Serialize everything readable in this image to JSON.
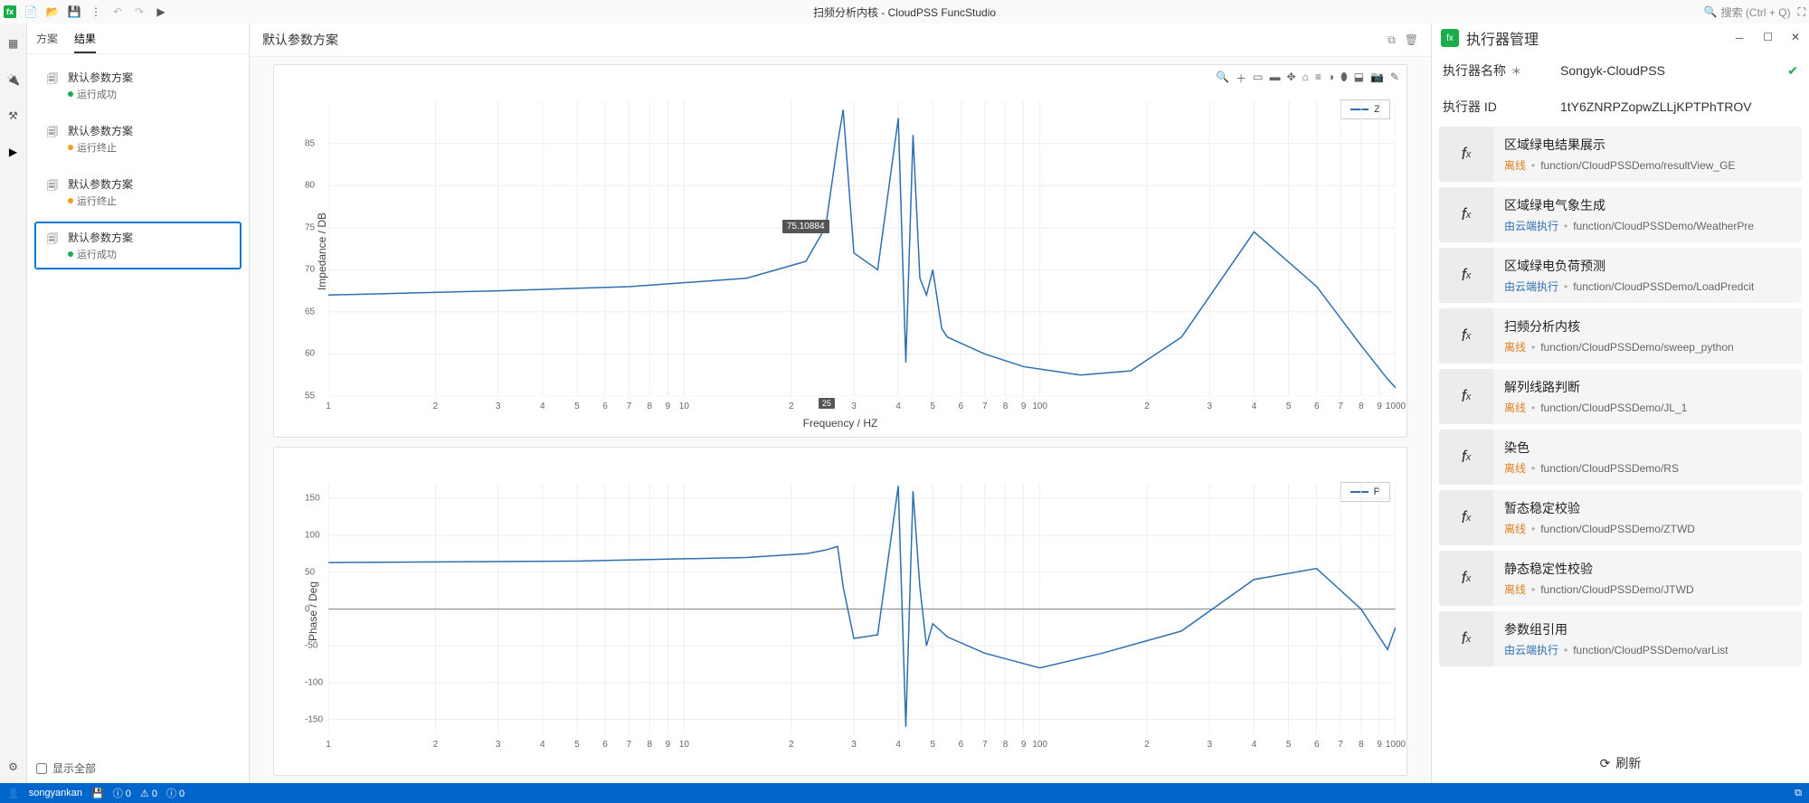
{
  "titlebar": {
    "title": "扫频分析内核 - CloudPSS FuncStudio",
    "search_placeholder": "搜索 (Ctrl + Q)"
  },
  "left_tabs": {
    "scheme": "方案",
    "result": "结果"
  },
  "schemes": [
    {
      "title": "默认参数方案",
      "status": "运行成功",
      "status_color": "green",
      "selected": false
    },
    {
      "title": "默认参数方案",
      "status": "运行终止",
      "status_color": "orange",
      "selected": false
    },
    {
      "title": "默认参数方案",
      "status": "运行终止",
      "status_color": "orange",
      "selected": false
    },
    {
      "title": "默认参数方案",
      "status": "运行成功",
      "status_color": "green",
      "selected": true
    }
  ],
  "show_all_label": "显示全部",
  "center_header": "默认参数方案",
  "chart_data": [
    {
      "type": "line",
      "title": "",
      "xlabel": "Frequency / HZ",
      "ylabel": "Impedance / DB",
      "x_scale": "log",
      "xlim": [
        1,
        1000
      ],
      "ylim": [
        55,
        90
      ],
      "yticks": [
        55,
        60,
        65,
        70,
        75,
        80,
        85
      ],
      "legend": "Z",
      "tooltip": {
        "x": 25,
        "y": 75.10884
      },
      "series": [
        {
          "name": "Z",
          "x": [
            1,
            3,
            7,
            15,
            22,
            25,
            27,
            28,
            30,
            35,
            40,
            42,
            44,
            46,
            48,
            50,
            53,
            55,
            70,
            90,
            130,
            180,
            250,
            400,
            600,
            800,
            950,
            1000
          ],
          "y": [
            67,
            67.5,
            68,
            69,
            71,
            75.1,
            85,
            89,
            72,
            70,
            88,
            59,
            86,
            69,
            67,
            70,
            63,
            62,
            60,
            58.5,
            57.5,
            58,
            62,
            74.5,
            68,
            61,
            57,
            56
          ]
        }
      ]
    },
    {
      "type": "line",
      "title": "",
      "xlabel": "Frequency / HZ",
      "ylabel": "Phase / Deg",
      "x_scale": "log",
      "xlim": [
        1,
        1000
      ],
      "ylim": [
        -170,
        170
      ],
      "yticks": [
        -150,
        -100,
        -50,
        0,
        50,
        100,
        150
      ],
      "legend": "P",
      "series": [
        {
          "name": "P",
          "x": [
            1,
            5,
            15,
            22,
            25,
            27,
            28,
            30,
            35,
            40,
            42,
            44,
            46,
            48,
            50,
            55,
            70,
            100,
            150,
            250,
            400,
            600,
            800,
            950,
            1000
          ],
          "y": [
            63,
            65,
            70,
            75,
            80,
            85,
            30,
            -40,
            -35,
            167,
            -160,
            160,
            30,
            -50,
            -20,
            -38,
            -60,
            -80,
            -60,
            -30,
            40,
            55,
            0,
            -55,
            -25
          ]
        }
      ]
    }
  ],
  "executor": {
    "panel_title": "执行器管理",
    "name_label": "执行器名称",
    "name_value": "Songyk-CloudPSS",
    "id_label": "执行器 ID",
    "id_value": "1tY6ZNRPZopwZLLjKPTPhTROV",
    "refresh_label": "刷新",
    "items": [
      {
        "title": "区域绿电结果展示",
        "status": "离线",
        "status_kind": "offline",
        "path": "function/CloudPSSDemo/resultView_GE"
      },
      {
        "title": "区域绿电气象生成",
        "status": "由云端执行",
        "status_kind": "cloud",
        "path": "function/CloudPSSDemo/WeatherPre"
      },
      {
        "title": "区域绿电负荷预测",
        "status": "由云端执行",
        "status_kind": "cloud",
        "path": "function/CloudPSSDemo/LoadPredcit"
      },
      {
        "title": "扫频分析内核",
        "status": "离线",
        "status_kind": "offline",
        "path": "function/CloudPSSDemo/sweep_python"
      },
      {
        "title": "解列线路判断",
        "status": "离线",
        "status_kind": "offline",
        "path": "function/CloudPSSDemo/JL_1"
      },
      {
        "title": "染色",
        "status": "离线",
        "status_kind": "offline",
        "path": "function/CloudPSSDemo/RS"
      },
      {
        "title": "暂态稳定校验",
        "status": "离线",
        "status_kind": "offline",
        "path": "function/CloudPSSDemo/ZTWD"
      },
      {
        "title": "静态稳定性校验",
        "status": "离线",
        "status_kind": "offline",
        "path": "function/CloudPSSDemo/JTWD"
      },
      {
        "title": "参数组引用",
        "status": "由云端执行",
        "status_kind": "cloud",
        "path": "function/CloudPSSDemo/varList"
      }
    ]
  },
  "statusbar": {
    "user": "songyankan",
    "info": "0",
    "warn": "0",
    "err": "0"
  }
}
